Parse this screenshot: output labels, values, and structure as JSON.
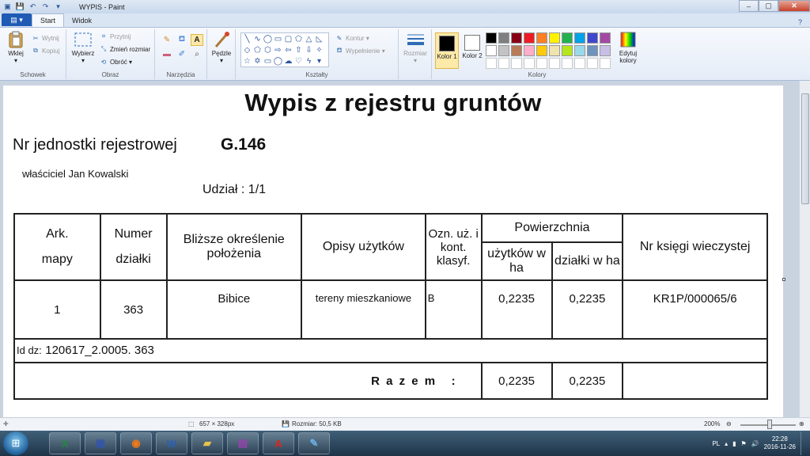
{
  "window": {
    "title": "WYPIS - Paint",
    "minimize": "–",
    "maximize": "▢",
    "close": "✕"
  },
  "tabs": {
    "file_menu": "▤ ▾",
    "start": "Start",
    "view": "Widok"
  },
  "ribbon": {
    "clipboard": {
      "label": "Schowek",
      "paste": "Wklej",
      "cut": "Wytnij",
      "copy": "Kopiuj"
    },
    "image": {
      "label": "Obraz",
      "select": "Wybierz",
      "crop": "Przytnij",
      "resize": "Zmień rozmiar",
      "rotate": "Obróć ▾"
    },
    "tools": {
      "label": "Narzędzia"
    },
    "brushes": {
      "label": "Pędzle"
    },
    "shapes": {
      "label": "Kształty",
      "outline": "Kontur ▾",
      "fill": "Wypełnienie ▾"
    },
    "size": {
      "label": "Rozmiar"
    },
    "colors": {
      "label": "Kolory",
      "color1": "Kolor 1",
      "color2": "Kolor 2",
      "edit": "Edytuj kolory",
      "color1_value": "#000000",
      "color2_value": "#ffffff",
      "palette": [
        "#000000",
        "#7f7f7f",
        "#880015",
        "#ed1c24",
        "#ff7f27",
        "#fff200",
        "#22b14c",
        "#00a2e8",
        "#3f48cc",
        "#a349a4",
        "#ffffff",
        "#c3c3c3",
        "#b97a57",
        "#ffaec9",
        "#ffc90e",
        "#efe4b0",
        "#b5e61d",
        "#99d9ea",
        "#7092be",
        "#c8bfe7"
      ]
    }
  },
  "document": {
    "title": "Wypis z rejestru gruntów",
    "unit_label": "Nr jednostki rejestrowej",
    "unit_value": "G.146",
    "owner": "właściciel Jan Kowalski",
    "share": "Udział : 1/1",
    "headers": {
      "ark": "Ark.",
      "mapy": "mapy",
      "numer": "Numer",
      "dzialki": "działki",
      "blizsze": "Bliższe określenie położenia",
      "opisy": "Opisy użytków",
      "ozn": "Ozn. uż. i kont. klasyf.",
      "powierzchnia": "Powierzchnia",
      "uzytkow_wha": "użytków w ha",
      "dzialki_wha": "działki w ha",
      "ksiega": "Nr księgi wieczystej"
    },
    "row": {
      "ark": "1",
      "numer": "363",
      "polozenie": "Bibice",
      "opis": "tereny mieszkaniowe",
      "ozn": "B",
      "pow_uzytkow": "0,2235",
      "pow_dzialki": "0,2235",
      "ksiega": "KR1P/000065/6"
    },
    "id_label": "Id dz:",
    "id_value": "120617_2.0005. 363",
    "total_label": "R a z e m   :",
    "total_uzytkow": "0,2235",
    "total_dzialki": "0,2235"
  },
  "status": {
    "dimensions": "657 × 328px",
    "size": "Rozmiar: 50,5 KB",
    "zoom": "200%"
  },
  "taskbar": {
    "language": "PL",
    "time": "22:28",
    "date": "2016-11-26"
  }
}
